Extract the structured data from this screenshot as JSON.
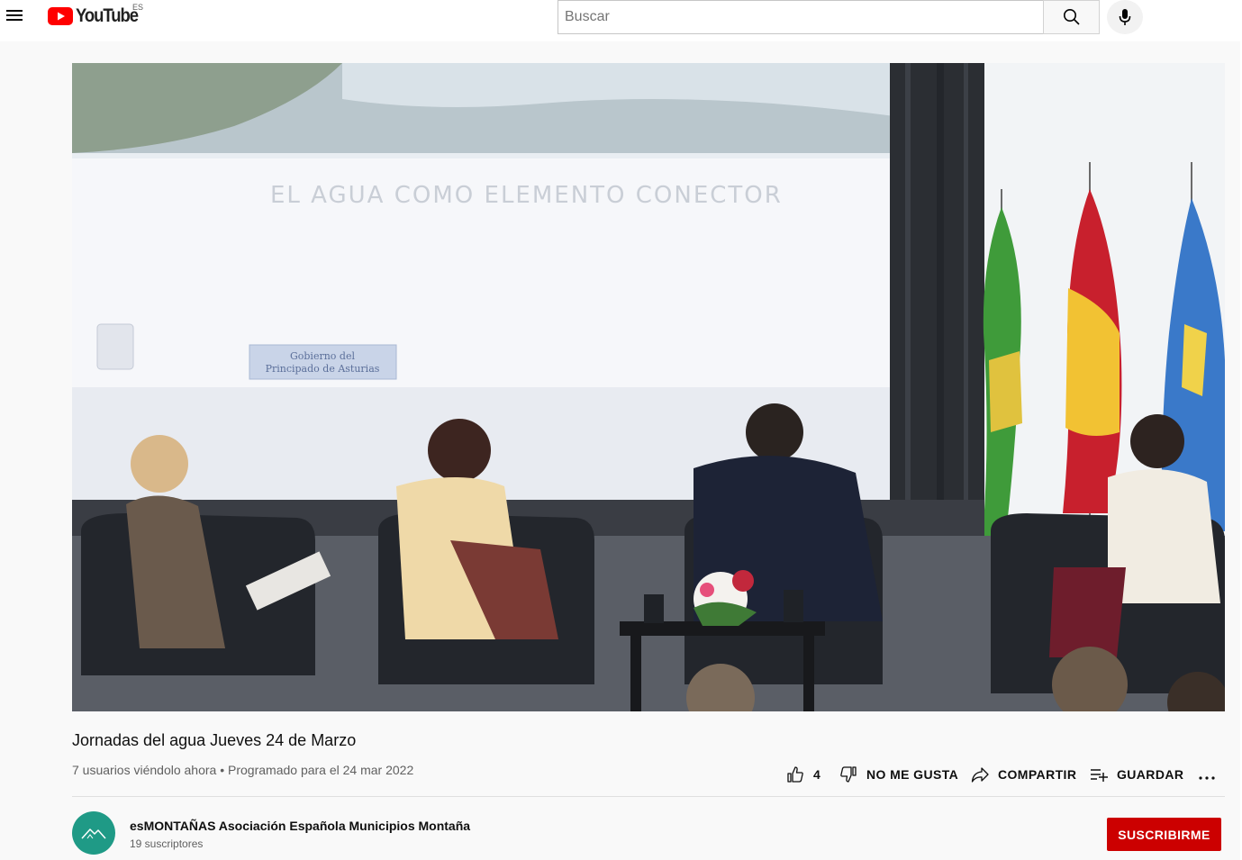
{
  "header": {
    "logo_text": "YouTube",
    "country_code": "ES",
    "search_placeholder": "Buscar"
  },
  "video": {
    "title": "Jornadas del agua Jueves 24 de Marzo",
    "meta": "7 usuarios viéndolo ahora • Programado para el 24 mar 2022",
    "screen_text": "EL AGUA COMO ELEMENTO CONECTOR",
    "screen_logo_text_line1": "Gobierno del",
    "screen_logo_text_line2": "Principado de Asturias"
  },
  "actions": {
    "like_count": "4",
    "dislike_label": "NO ME GUSTA",
    "share_label": "COMPARTIR",
    "save_label": "GUARDAR"
  },
  "channel": {
    "name": "esMONTAÑAS Asociación Española Municipios Montaña",
    "subscribers": "19 suscriptores",
    "subscribe_label": "SUSCRIBIRME"
  },
  "colors": {
    "brand_red": "#ff0000",
    "subscribe_red": "#cc0000",
    "avatar_teal": "#1f9a86"
  },
  "icons": [
    "menu-icon",
    "youtube-play-icon",
    "search-icon",
    "microphone-icon",
    "thumbs-up-icon",
    "thumbs-down-icon",
    "share-icon",
    "save-playlist-icon",
    "more-icon"
  ]
}
